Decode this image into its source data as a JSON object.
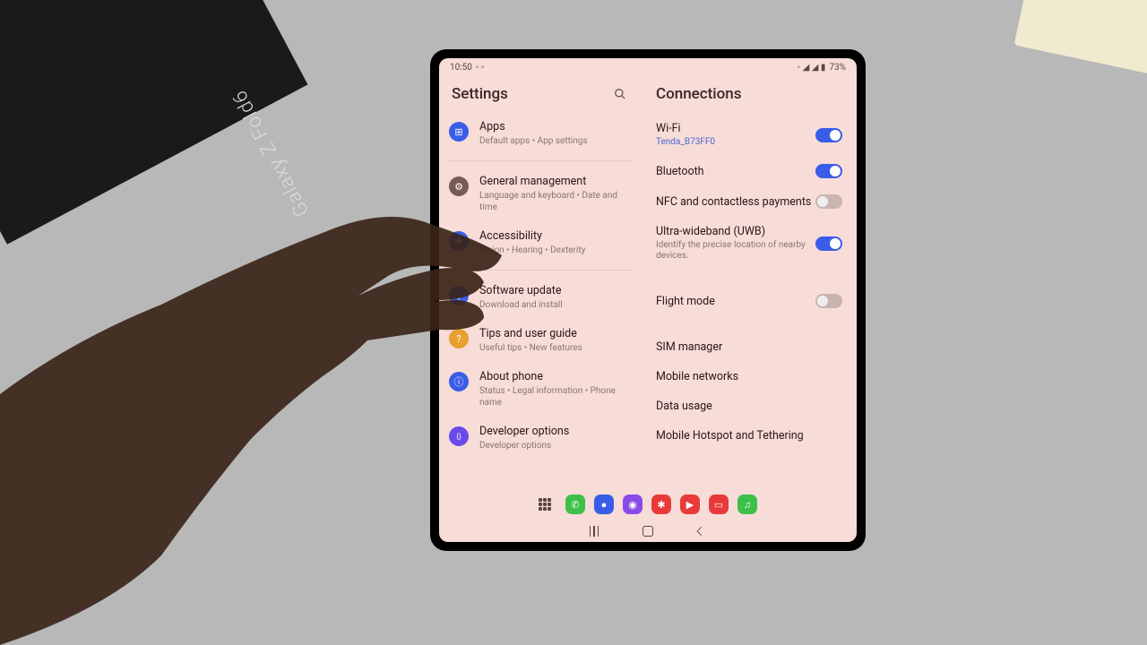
{
  "bg_box_text": "Galaxy Z Fold6",
  "statusbar": {
    "time": "10:50",
    "battery": "73%"
  },
  "left": {
    "title": "Settings",
    "items": [
      {
        "label": "Apps",
        "sub": "Default apps • App settings",
        "color": "#3a5de8",
        "glyph": "⊞"
      },
      {
        "label": "General management",
        "sub": "Language and keyboard • Date and time",
        "color": "#7a5a55",
        "glyph": "⚙"
      },
      {
        "label": "Accessibility",
        "sub": "Vision • Hearing • Dexterity",
        "color": "#3a5de8",
        "glyph": "✚"
      },
      {
        "label": "Software update",
        "sub": "Download and install",
        "color": "#3a5de8",
        "glyph": "↓"
      },
      {
        "label": "Tips and user guide",
        "sub": "Useful tips • New features",
        "color": "#e8a030",
        "glyph": "?"
      },
      {
        "label": "About phone",
        "sub": "Status • Legal information • Phone name",
        "color": "#3a5de8",
        "glyph": "ⓘ"
      },
      {
        "label": "Developer options",
        "sub": "Developer options",
        "color": "#6a4ae8",
        "glyph": "{}"
      }
    ]
  },
  "right": {
    "title": "Connections",
    "wifi": {
      "label": "Wi-Fi",
      "network": "Tenda_B73FF0",
      "on": true
    },
    "bluetooth": {
      "label": "Bluetooth",
      "on": true
    },
    "nfc": {
      "label": "NFC and contactless payments",
      "on": false
    },
    "uwb": {
      "label": "Ultra-wideband (UWB)",
      "sub": "Identify the precise location of nearby devices.",
      "on": true
    },
    "flight": {
      "label": "Flight mode",
      "on": false
    },
    "sim": {
      "label": "SIM manager"
    },
    "mobile": {
      "label": "Mobile networks"
    },
    "data": {
      "label": "Data usage"
    },
    "hotspot": {
      "label": "Mobile Hotspot and Tethering"
    }
  },
  "dock": {
    "apps": [
      {
        "color": "#3cc048",
        "glyph": "✆"
      },
      {
        "color": "#3a5de8",
        "glyph": "●"
      },
      {
        "color": "#8a4ae8",
        "glyph": "◉"
      },
      {
        "color": "#e83a3a",
        "glyph": "✱"
      },
      {
        "color": "#e83a3a",
        "glyph": "▶"
      },
      {
        "color": "#e83a3a",
        "glyph": "▭"
      },
      {
        "color": "#3cc048",
        "glyph": "♫"
      }
    ]
  }
}
